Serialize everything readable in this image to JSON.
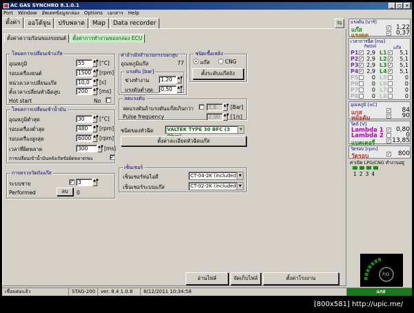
{
  "window": {
    "title": "AC GAS SYNCHRO  8.1.0.1",
    "min": "_",
    "max": "□",
    "close": "×"
  },
  "menu": [
    "Port",
    "Window",
    "อัพเดทข้อมูลกล่อง",
    "Options",
    "เอกสาร",
    "Help"
  ],
  "tabs": [
    "ตั้งค่า",
    "ออโต้จูน",
    "ปรับพลาต",
    "Map",
    "Data recorder"
  ],
  "subtabs": [
    "ตั้งค่าความร้อนของรถยนต์",
    "ตั้งค่าการทำงานของกล่อง ECU"
  ],
  "gas_switch": {
    "title": "โหมดการเปลี่ยนเข้าแก๊ส",
    "rows": [
      {
        "label": "อุณหภูมิ",
        "value": "55",
        "unit": "[°C]"
      },
      {
        "label": "รอบเครื่องยนต์",
        "value": "1500",
        "unit": "[rpm]"
      },
      {
        "label": "หน่วงเวลาเปลี่ยนแก๊ส",
        "value": "10,0",
        "unit": "[s]"
      },
      {
        "label": "ตั้งเวลาเปลี่ยนหัวฉีดสูบ",
        "value": "200",
        "unit": "[ms]"
      }
    ],
    "hotstart_label": "Hot start",
    "hotstart_value": "No"
  },
  "petrol_switch": {
    "title": "โหมดการเปลี่ยนเข้าน้ำมัน",
    "rows": [
      {
        "label": "อุณหภูมิต่ำสุด",
        "value": "30",
        "unit": "[°C]"
      },
      {
        "label": "รอบเครื่องต่ำสุด",
        "value": "480",
        "unit": "[rpm]"
      },
      {
        "label": "รอบเครื่องสูงสุด",
        "value": "6000",
        "unit": "[rpm]"
      }
    ],
    "delay_label": "เวลาที่ผิดพลาด",
    "delay_value": "300",
    "delay_unit": "[ms]",
    "error_label": "การเปลี่ยนเข้าน้ำมันหลังเกิดข้อผิดพลาดYes"
  },
  "cylinders": {
    "label": "ค่าอ้างอิงจำนวนกระบอกสูบ",
    "sub": "อุณหภูมิแก๊ส",
    "value": "77"
  },
  "pressure": {
    "title": "แรงดัน [bar]",
    "rows": [
      {
        "label": "ช่วงทำงาน",
        "value": "1,20"
      },
      {
        "label": "แรงดันต่ำสุด",
        "value": "0,50"
      }
    ]
  },
  "fuel": {
    "title": "ชนิดเชื้อเพลิง",
    "opt1": "แก๊ส",
    "opt2": "CNG",
    "button": "ตั้งระดับแก๊สถัง"
  },
  "reducer": {
    "title": "ลดแรงดัน",
    "threshold_label": "ลดแรงดันถ้าแรงดันแก๊สเกินกว่า",
    "threshold_value": "1,6",
    "threshold_unit": "[Bar]",
    "pulse_label": "Pulse frequency",
    "pulse_value": "2,00",
    "pulse_unit": "[1/s]"
  },
  "injector": {
    "label": "ชนิดของหัวฉีด",
    "value": "VALTEK TYPE 30 BFC (3 Ohm)",
    "button": "ตั้งค่าละเอียดหัวฉีดแก๊ส"
  },
  "tank_test": {
    "title": "การตรวจวัดถังแก๊ส",
    "label": "ระบบชาย",
    "value": "3",
    "performed_label": "Performed",
    "performed_btn": "ลบ",
    "performed_value": "0"
  },
  "sensors": {
    "title": "เซ็นเซอร์",
    "row1_label": "เซ็นเซอร์ท่อไอดี",
    "row1_value": "CT-04-2K (included in",
    "row2_label": "เซ็นเซอร์ระบบแก๊ส",
    "row2_value": "CT-02-2K (included in"
  },
  "buttons": {
    "read": "อ่านไฟล์",
    "save": "จัดเก็บไฟล์",
    "factory": "ตั้งค่าโรงงาน"
  },
  "status": {
    "s1": "เชื่อมต่อแล้ว",
    "s2": "STAG-200",
    "s3": "ver. 8.4  1.0.8",
    "s4": "8/12/2011  10:34:58"
  },
  "right": {
    "p1": {
      "title": "แรงดัน [บาร์]",
      "rows": [
        {
          "label": "แก๊ส",
          "value": "1,22",
          "color": "#1a8a1a"
        },
        {
          "label": "แรงดูด",
          "value": "0,37",
          "color": "#8a6a00"
        }
      ]
    },
    "p2": {
      "title": "เวลาการฉีด [ms]",
      "head_petrol": "Petrol",
      "head_gas": "แก๊ส",
      "rows": [
        {
          "p": "P1",
          "pv": "2,9",
          "l": "L1",
          "lv": "5,1"
        },
        {
          "p": "P2",
          "pv": "2,9",
          "l": "L2",
          "lv": "5,1"
        },
        {
          "p": "P3",
          "pv": "2,9",
          "l": "L3",
          "lv": "5,1"
        },
        {
          "p": "P4",
          "pv": "2,9",
          "l": "L4",
          "lv": "5,1"
        },
        {
          "p": "P5",
          "pv": "0",
          "l": "L5",
          "lv": "0"
        },
        {
          "p": "P6",
          "pv": "0",
          "l": "L6",
          "lv": "0"
        },
        {
          "p": "P7",
          "pv": "0",
          "l": "L7",
          "lv": "0"
        },
        {
          "p": "P8",
          "pv": "0",
          "l": "L8",
          "lv": "0"
        }
      ]
    },
    "p3": {
      "title": "อุณหภูมิ [oC]",
      "rows": [
        {
          "label": "แกส",
          "value": "84",
          "color": "#c03030"
        },
        {
          "label": "หม้อต้ม",
          "value": "90",
          "color": "#c03030"
        }
      ]
    },
    "p4": {
      "title": "วัตถ์ [V]",
      "rows": [
        {
          "label": "Lambda 1",
          "value": "0,80",
          "color": "#c000c0"
        },
        {
          "label": "Lambda 2",
          "value": "0",
          "color": "#c000c0"
        },
        {
          "label": "แบตเตอรี่",
          "value": "13,85",
          "color": "#0a8a0a"
        }
      ]
    },
    "p5": {
      "title": "วัดรอบ [rpm]",
      "label": "วัดรอบ",
      "value": "800"
    },
    "p6": {
      "title": "ค่าเปิด LPG/CNG ทำงานอยู่",
      "nums": [
        "1",
        "2",
        "3",
        "4"
      ]
    },
    "logo_text": "P/G",
    "gas_label": "แกส"
  },
  "watermark": "[800x581] http://upic.me/"
}
